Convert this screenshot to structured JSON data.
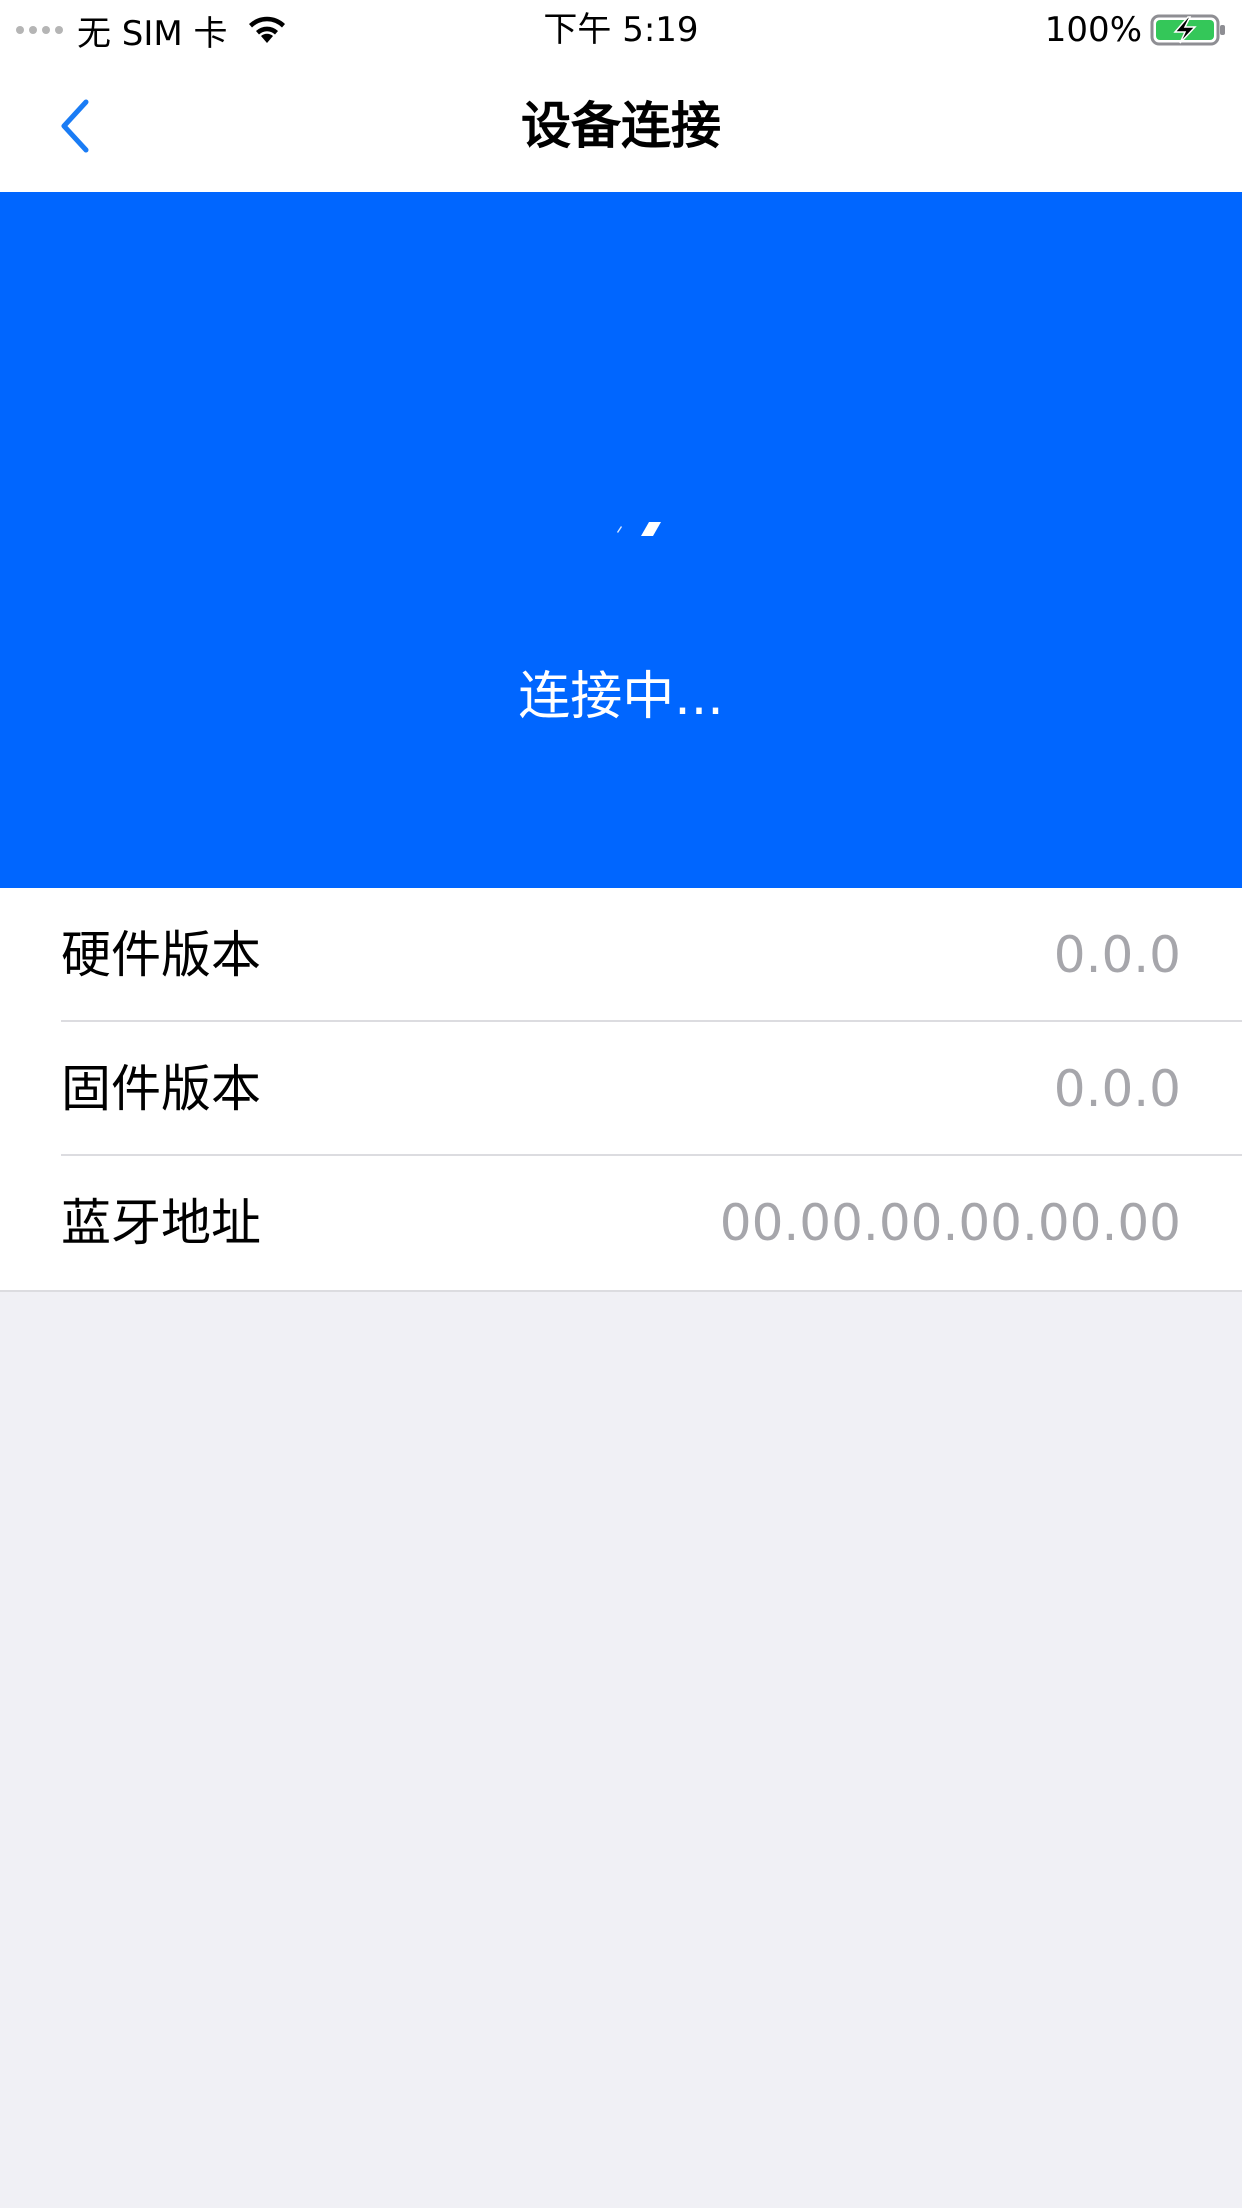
{
  "status_bar": {
    "carrier": "无 SIM 卡",
    "time": "下午 5:19",
    "battery_percent": "100%",
    "icons": [
      "signal-dots-icon",
      "wifi-icon",
      "battery-charging-icon"
    ],
    "battery_color": "#34C759"
  },
  "nav": {
    "title": "设备连接",
    "back_icon": "chevron-left-icon",
    "accent_color": "#1A7CF5"
  },
  "connect_panel": {
    "status_text": "连接中...",
    "background_color": "#0066FF",
    "spinner_icon": "loading-spinner-icon"
  },
  "device_info": {
    "rows": [
      {
        "label": "硬件版本",
        "value": "0.0.0"
      },
      {
        "label": "固件版本",
        "value": "0.0.0"
      },
      {
        "label": "蓝牙地址",
        "value": "00.00.00.00.00.00"
      }
    ]
  }
}
